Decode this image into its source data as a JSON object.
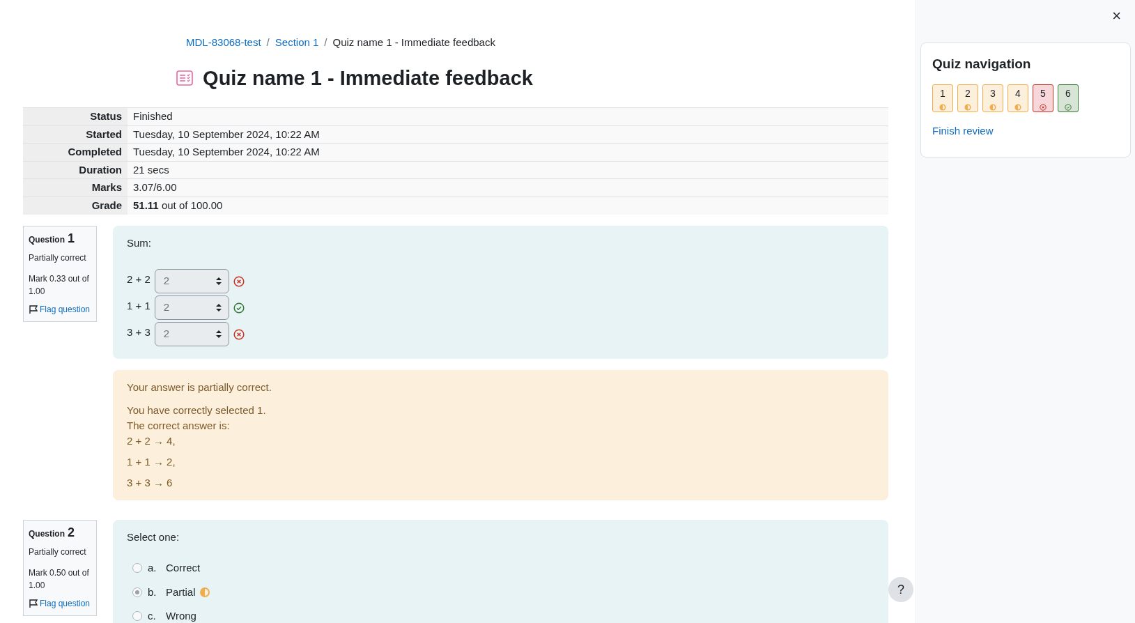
{
  "breadcrumb": [
    {
      "label": "MDL-83068-test",
      "link": true
    },
    {
      "label": "Section 1",
      "link": true
    },
    {
      "label": "Quiz name 1 - Immediate feedback",
      "link": false
    }
  ],
  "breadcrumb_separator": "/",
  "title": "Quiz name 1 - Immediate feedback",
  "summary": [
    {
      "label": "Status",
      "value": "Finished"
    },
    {
      "label": "Started",
      "value": "Tuesday, 10 September 2024, 10:22 AM"
    },
    {
      "label": "Completed",
      "value": "Tuesday, 10 September 2024, 10:22 AM"
    },
    {
      "label": "Duration",
      "value": "21 secs"
    },
    {
      "label": "Marks",
      "value": "3.07/6.00"
    },
    {
      "label": "Grade",
      "value": "**51.11** out of 100.00"
    }
  ],
  "questions": [
    {
      "label": "Question",
      "number": "1",
      "state": "Partially correct",
      "mark": "Mark 0.33 out of 1.00",
      "flag": "Flag question",
      "kind": "match",
      "prompt": "Sum:",
      "items": [
        {
          "stem": "2 + 2",
          "value": "2",
          "kind": "incorrect"
        },
        {
          "stem": "1 + 1",
          "value": "2",
          "kind": "correct"
        },
        {
          "stem": "3 + 3",
          "value": "2",
          "kind": "incorrect"
        }
      ],
      "feedback": {
        "summary": "Your answer is partially correct.",
        "lines": [
          "You have correctly selected 1.",
          "The correct answer is:"
        ],
        "answers": [
          "2 + 2 → 4,",
          "1 + 1 → 2,",
          "3 + 3 → 6"
        ]
      }
    },
    {
      "label": "Question",
      "number": "2",
      "state": "Partially correct",
      "mark": "Mark 0.50 out of 1.00",
      "flag": "Flag question",
      "kind": "choice",
      "prompt": "Select one:",
      "options": [
        {
          "letter": "a.",
          "text": "Correct",
          "selected": false,
          "kind": "plain"
        },
        {
          "letter": "b.",
          "text": "Partial",
          "selected": true,
          "kind": "partial"
        },
        {
          "letter": "c.",
          "text": "Wrong",
          "selected": false,
          "kind": "plain"
        }
      ]
    }
  ],
  "help": "?",
  "drawer": {
    "close": "×",
    "title": "Quiz navigation",
    "buttons": [
      {
        "number": "1",
        "kind": "partial"
      },
      {
        "number": "2",
        "kind": "partial"
      },
      {
        "number": "3",
        "kind": "partial"
      },
      {
        "number": "4",
        "kind": "partial"
      },
      {
        "number": "5",
        "kind": "incorrect"
      },
      {
        "number": "6",
        "kind": "correct"
      }
    ],
    "finish": "Finish review"
  }
}
